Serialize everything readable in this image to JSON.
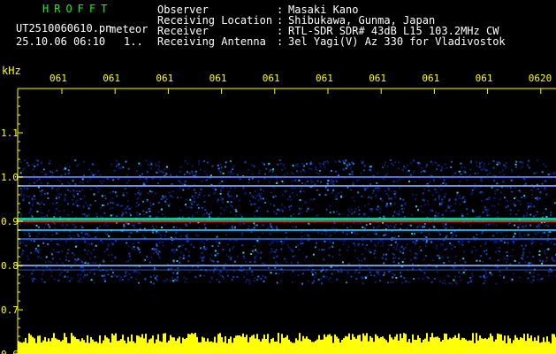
{
  "header": {
    "app_name": "HROFFT",
    "filename": "UT2510060610.pn",
    "mode": "meteor",
    "datetime": "25.10.06 06:10",
    "extra": "1..",
    "info": [
      {
        "label": "Observer",
        "value": "Masaki Kano"
      },
      {
        "label": "Receiving Location",
        "value": "Shibukawa, Gunma, Japan"
      },
      {
        "label": "Receiver",
        "value": "RTL-SDR SDR# 43dB L15 103.2MHz CW"
      },
      {
        "label": "Receiving Antenna",
        "value": "3el Yagi(V) Az 330 for Vladivostok"
      }
    ]
  },
  "axis": {
    "unit": "kHz",
    "y_ticks": [
      "1.1",
      "1.0",
      "0.9",
      "0.8",
      "0.7",
      "0.6"
    ],
    "y_range": [
      0.6,
      1.2
    ],
    "time_ticks": [
      "061",
      "061",
      "061",
      "061",
      "061",
      "061",
      "061",
      "061",
      "061",
      "0620"
    ]
  },
  "colors": {
    "background": "#000000",
    "axis": "#ffff00",
    "label_green": "#00ff00",
    "label_white": "#ffffff",
    "signal_line": "#ff2020"
  }
}
